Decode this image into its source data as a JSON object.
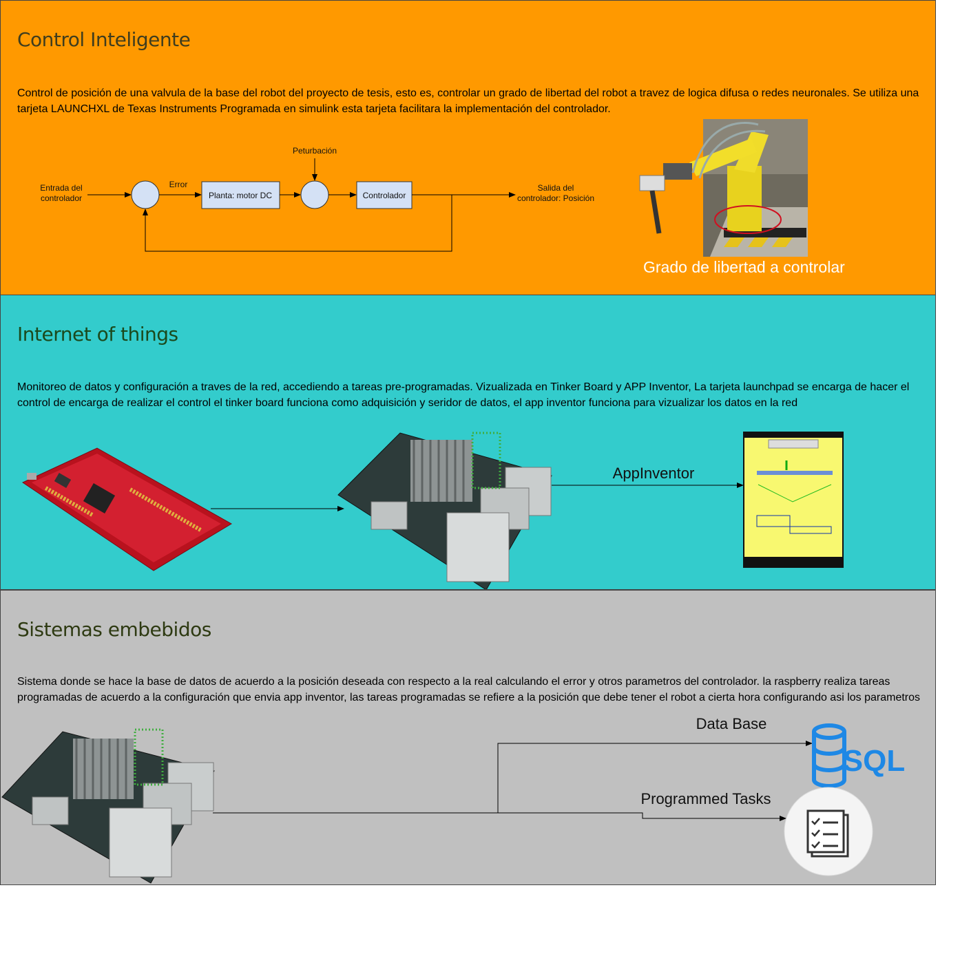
{
  "colors": {
    "control_bg": "#FF9900",
    "iot_bg": "#33CCCC",
    "embedded_bg": "#C0C0C0",
    "title_control": "#3F3D1E",
    "title_iot": "#1B4A1D",
    "title_embedded": "#2E3A12",
    "block_fill": "#D4E1F5",
    "sql_blue": "#1E88E5"
  },
  "control": {
    "title": "Control Inteligente",
    "description": "Control de posición de una valvula de la base del robot del proyecto de tesis, esto es, controlar un grado de libertad del robot a travez de logica difusa o redes neuronales. Se utiliza una tarjeta LAUNCHXL de Texas Instruments Programada en simulink esta tarjeta facilitara la implementación del controlador.",
    "diagram": {
      "input_label_1": "Entrada del",
      "input_label_2": "controlador",
      "error_label": "Error",
      "plant_label": "Planta: motor DC",
      "disturbance_label": "Peturbación",
      "controller_label": "Controlador",
      "output_label_1": "Salida del",
      "output_label_2": "controlador: Posición"
    },
    "robot_caption": "Grado de libertad a controlar",
    "robot_icon": "robot-arm-icon"
  },
  "iot": {
    "title": "Internet of things",
    "description": "Monitoreo de datos y configuración a traves de la red, accediendo a tareas pre-programadas. Vizualizada en Tinker Board y APP Inventor, La tarjeta launchpad se encarga de hacer el control de encarga de realizar el control el tinker board funciona como adquisición y seridor de datos, el app inventor funciona para vizualizar los datos en la red",
    "app_label": "AppInventor",
    "launchpad_icon": "launchpad-board-icon",
    "tinker_icon": "tinker-board-icon",
    "phone_icon": "phone-app-icon"
  },
  "embedded": {
    "title": "Sistemas embebidos",
    "description": "Sistema donde se hace la base de datos de acuerdo a la posición deseada con respecto a la real calculando el error y otros parametros del controlador. la raspberry realiza tareas programadas de acuerdo a la configuración que envia app inventor, las tareas programadas se refiere a la posición que debe tener el robot a cierta hora configurando asi los parametros",
    "database_label": "Data Base",
    "tasks_label": "Programmed Tasks",
    "sql_text": "SQL",
    "database_icon": "database-icon",
    "tasks_icon": "checklist-icon"
  }
}
